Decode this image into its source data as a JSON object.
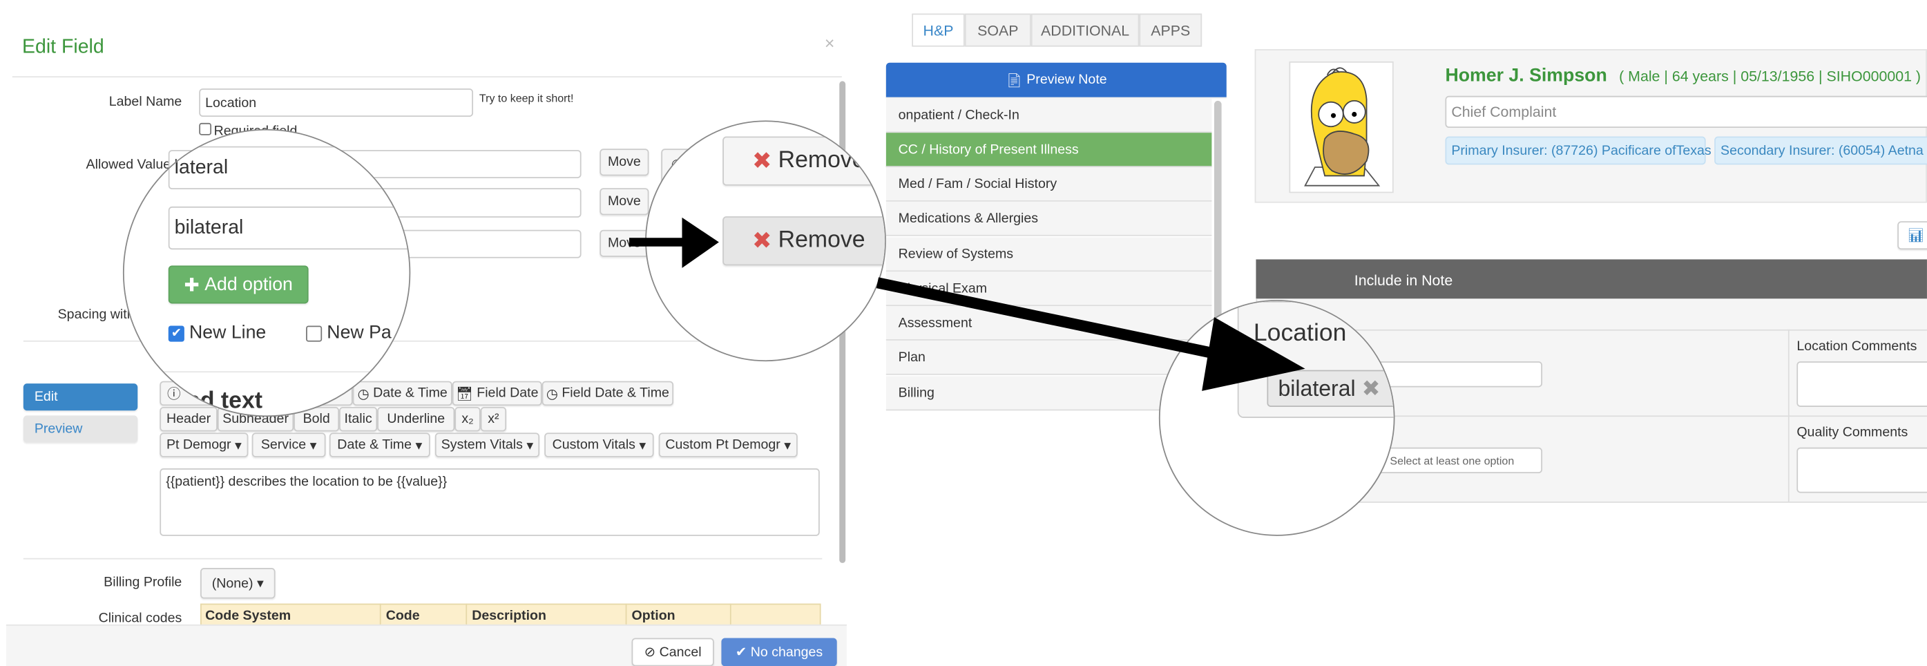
{
  "modal": {
    "title": "Edit Field",
    "close_icon": "×",
    "label_name_label": "Label Name",
    "label_name_value": "Location",
    "label_hint": "Try to keep it short!",
    "required_field_label": "Required field",
    "allowed_values_label": "Allowed Values",
    "allowed_values": [
      "lateral",
      "",
      "bilateral"
    ],
    "move_label": "Move",
    "remove_label": "Remove",
    "add_option_label": "Add option",
    "spacing_label": "Spacing with",
    "new_line_label": "New Line",
    "new_line_checked": true,
    "new_page_label": "New Pa",
    "mode_tabs": [
      {
        "label": "Edit",
        "active": true
      },
      {
        "label": "Preview",
        "active": false
      }
    ],
    "toolbar_row1": [
      "ted text",
      "Date & Time",
      "Field Date",
      "Field Date & Time"
    ],
    "toolbar_row2": [
      "Header",
      "Subheader",
      "Bold",
      "Italic",
      "Underline",
      "x₂",
      "x²"
    ],
    "toolbar_row3": [
      "Pt Demogr",
      "Service",
      "Date & Time",
      "System Vitals",
      "Custom Vitals",
      "Custom Pt Demogr"
    ],
    "template_text": "{{patient}} describes the location to be {{value}}",
    "billing_profile_label": "Billing Profile",
    "billing_profile_value": "(None)",
    "clinical_codes_label": "Clinical codes",
    "codes_columns": [
      "Code System",
      "Code",
      "Description",
      "Option",
      ""
    ],
    "cancel_label": "Cancel",
    "save_label": "No changes",
    "colors": {
      "title": "#3c963c",
      "primary": "#3a87c8",
      "success": "#6ab46a",
      "save": "#5b8ad6",
      "table_header": "#fcefcc"
    }
  },
  "app": {
    "tabs": [
      {
        "label": "H&P",
        "active": true
      },
      {
        "label": "SOAP"
      },
      {
        "label": "ADDITIONAL"
      },
      {
        "label": "APPS"
      }
    ],
    "preview_note_label": "Preview Note",
    "sections": [
      "onpatient / Check-In",
      "CC / History of Present Illness",
      "Med / Fam / Social History",
      "Medications & Allergies",
      "Review of Systems",
      "Physical Exam",
      "Assessment",
      "Plan",
      "Billing"
    ],
    "active_section": 1,
    "patient": {
      "name": "Homer J. Simpson",
      "sex": "Male",
      "age": "64 years",
      "dob": "05/13/1956",
      "id": "SIHO000001",
      "chief_complaint_placeholder": "Chief Complaint",
      "primary_insurer": "Primary Insurer: (87726) Pacificare ofTexas",
      "secondary_insurer": "Secondary Insurer: (60054) Aetna"
    },
    "include_in_note_label": "Include in Note",
    "field_label": "Location",
    "selected_tag": "bilateral",
    "select_placeholder": "Select at least one option",
    "location_comments_label": "Location Comments",
    "quality_comments_label": "Quality Comments",
    "colors": {
      "preview_bar": "#2f6fcc",
      "active_section": "#72b365",
      "name": "#3c963c",
      "insurer_bg": "#dceefa",
      "insurer_text": "#3a88c0",
      "dark_bar": "#666666"
    }
  }
}
